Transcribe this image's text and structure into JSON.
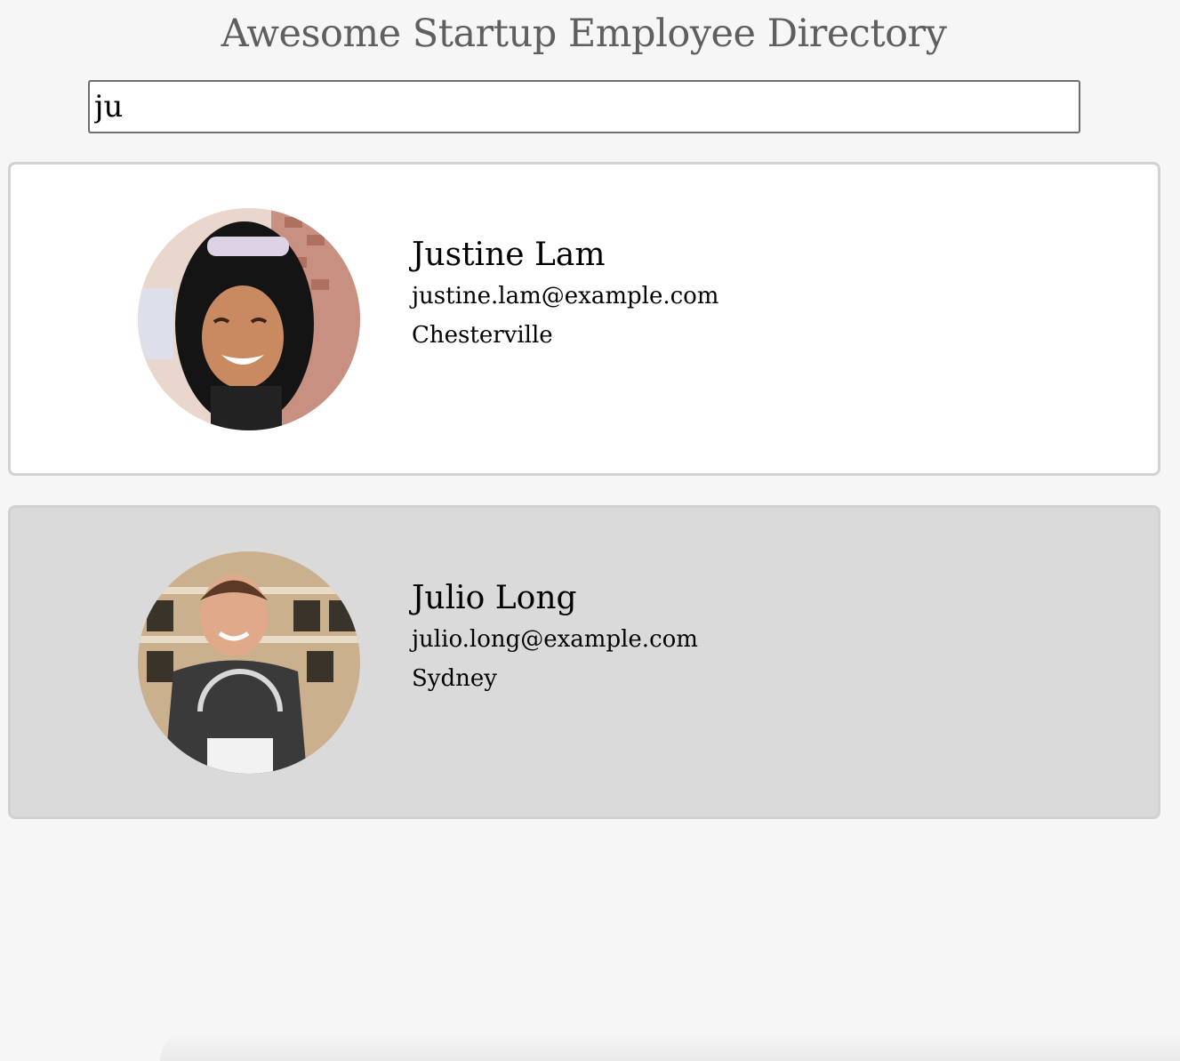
{
  "header": {
    "title": "Awesome Startup Employee Directory"
  },
  "search": {
    "value": "ju"
  },
  "employees": [
    {
      "name": "Justine Lam",
      "email": "justine.lam@example.com",
      "city": "Chesterville"
    },
    {
      "name": "Julio Long",
      "email": "julio.long@example.com",
      "city": "Sydney"
    }
  ],
  "colors": {
    "page_background": "#f6f6f6",
    "title_text": "#5f5f5f",
    "card_white": "#ffffff",
    "card_grey": "#dadada",
    "card_border": "#d2d2d2"
  }
}
